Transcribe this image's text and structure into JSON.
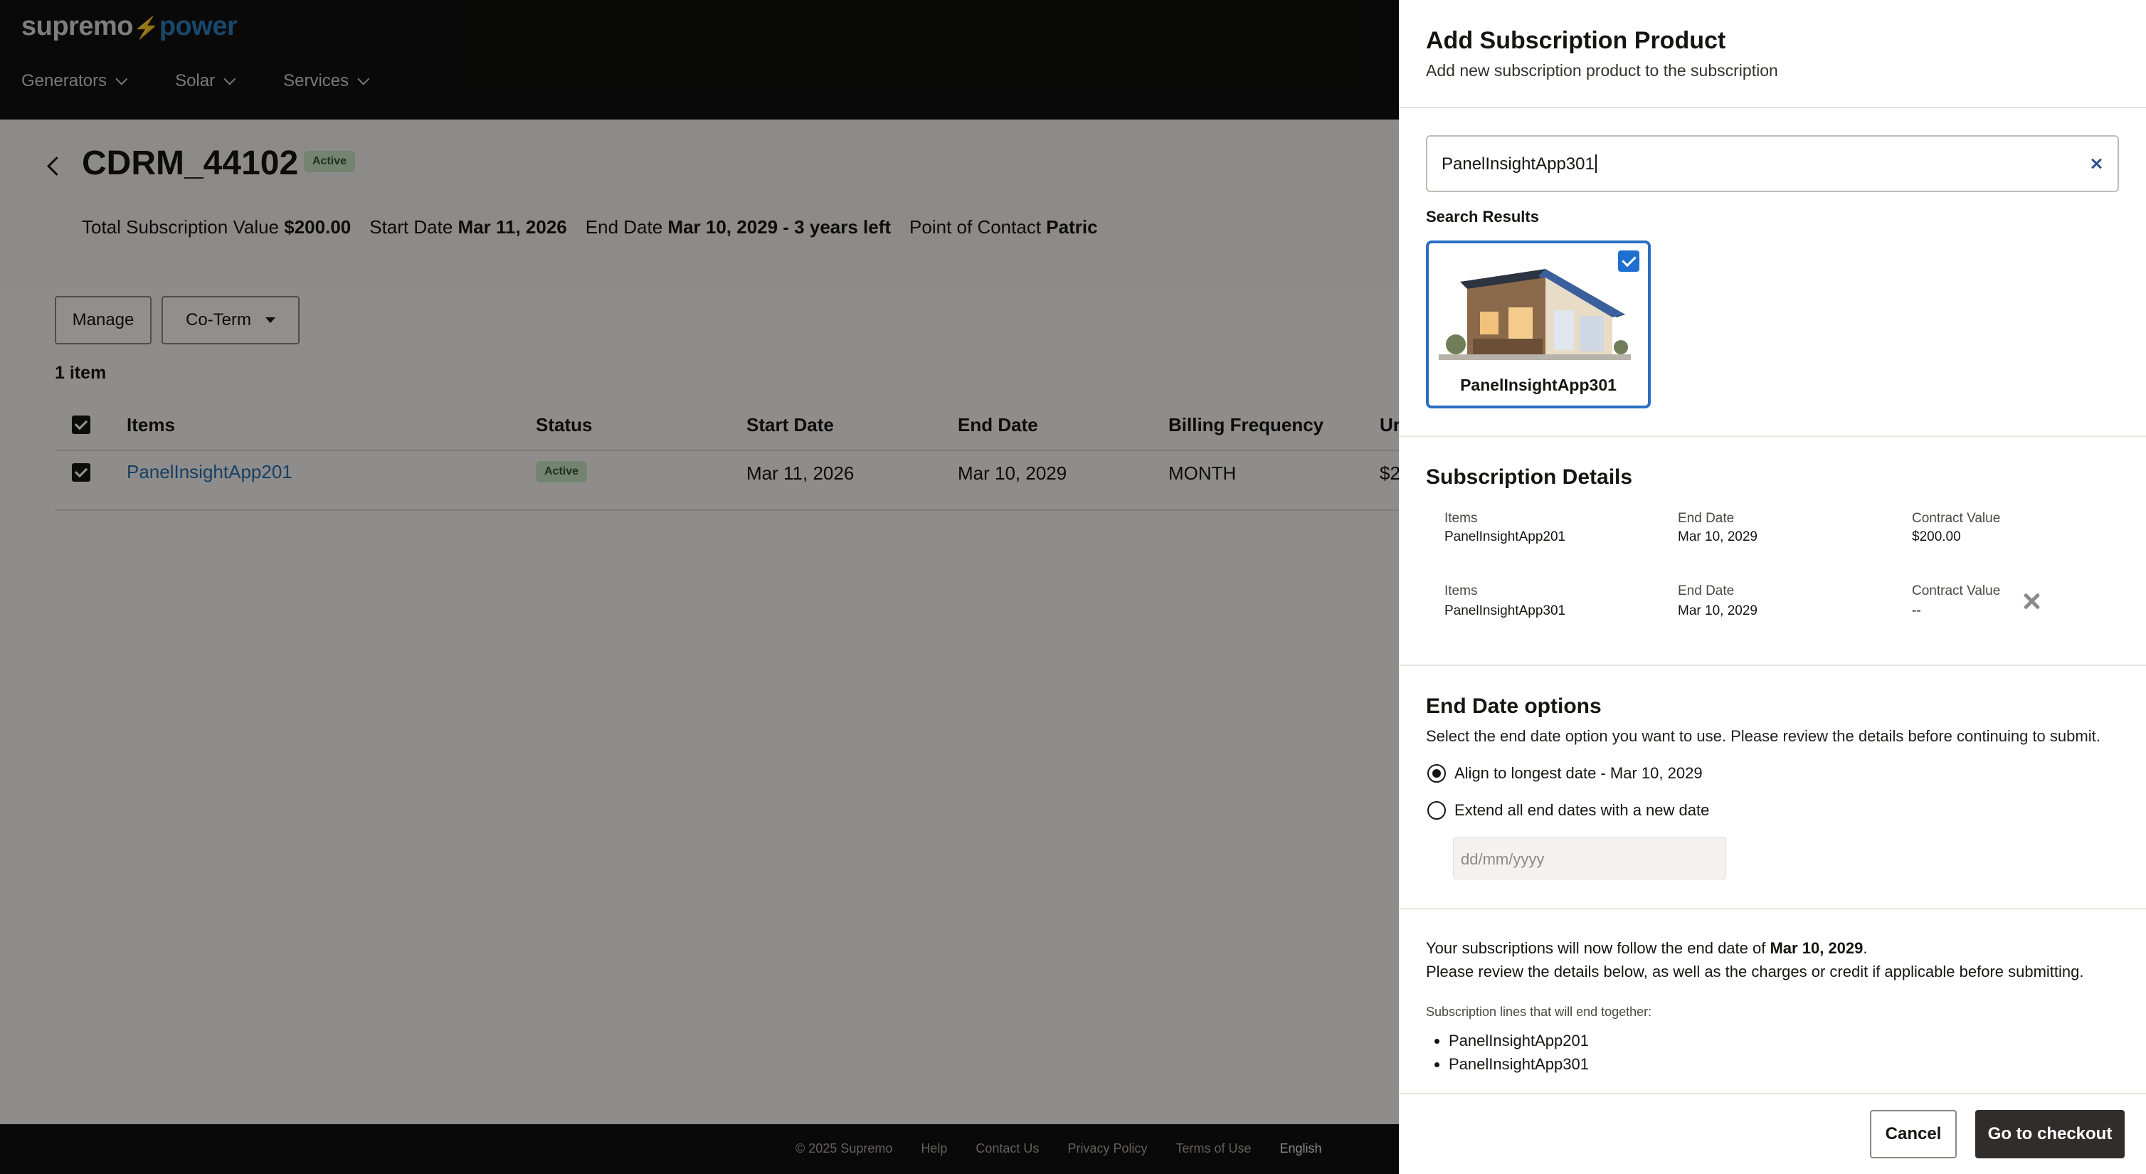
{
  "brand": {
    "part1": "supremo",
    "bolt": "⚡",
    "part2": "power"
  },
  "nav": [
    {
      "label": "Generators"
    },
    {
      "label": "Solar"
    },
    {
      "label": "Services"
    }
  ],
  "record": {
    "title": "CDRM_44102",
    "status": "Active",
    "total_label": "Total Subscription Value",
    "total_value": "$200.00",
    "start_label": "Start Date",
    "start_value": "Mar 11, 2026",
    "end_label": "End Date",
    "end_value": "Mar 10, 2029 - 3 years left",
    "contact_label": "Point of Contact",
    "contact_value": "Patric"
  },
  "toolbar": {
    "manage_label": "Manage",
    "coterm_label": "Co-Term"
  },
  "table": {
    "count": "1 item",
    "headers": [
      "Items",
      "Status",
      "Start Date",
      "End Date",
      "Billing Frequency",
      "Ur"
    ],
    "rows": [
      {
        "item": "PanelInsightApp201",
        "status": "Active",
        "start": "Mar 11, 2026",
        "end": "Mar 10, 2029",
        "billing": "MONTH",
        "unit": "$2"
      }
    ]
  },
  "footer": {
    "copyright": "© 2025 Supremo",
    "links": [
      "Help",
      "Contact Us",
      "Privacy Policy",
      "Terms of Use"
    ],
    "language": "English"
  },
  "panel": {
    "title": "Add Subscription Product",
    "subtitle": "Add new subscription product to the subscription",
    "search": {
      "value": "PanelInsightApp301"
    },
    "results_label": "Search Results",
    "results": [
      {
        "name": "PanelInsightApp301",
        "selected": true
      }
    ],
    "details": {
      "title": "Subscription Details",
      "items_label": "Items",
      "end_label": "End Date",
      "value_label": "Contract Value",
      "lines": [
        {
          "item": "PanelInsightApp201",
          "end": "Mar 10, 2029",
          "value": "$200.00"
        },
        {
          "item": "PanelInsightApp301",
          "end": "Mar 10, 2029",
          "value": "--"
        }
      ]
    },
    "end_options": {
      "title": "End Date options",
      "description": "Select the end date option you want to use. Please review the details before continuing to submit.",
      "option1": "Align to longest date - Mar 10, 2029",
      "option2": "Extend all end dates with a new date",
      "selected": "option1",
      "date_placeholder": "dd/mm/yyyy"
    },
    "summary": {
      "line1_prefix": "Your subscriptions will now follow the end date of",
      "line1_date": "Mar 10, 2029",
      "line1_suffix": ".",
      "line2": "Please review the details below, as well as the charges or credit if applicable before submitting.",
      "lines_label": "Subscription lines that will end together:",
      "lines": [
        "PanelInsightApp201",
        "PanelInsightApp301"
      ]
    },
    "cancel_label": "Cancel",
    "checkout_label": "Go to checkout"
  },
  "colors": {
    "accent": "#2a6fc4",
    "primary_button": "#312d2a",
    "active_badge": "#c9e3c3",
    "link": "#2a6ca6"
  }
}
